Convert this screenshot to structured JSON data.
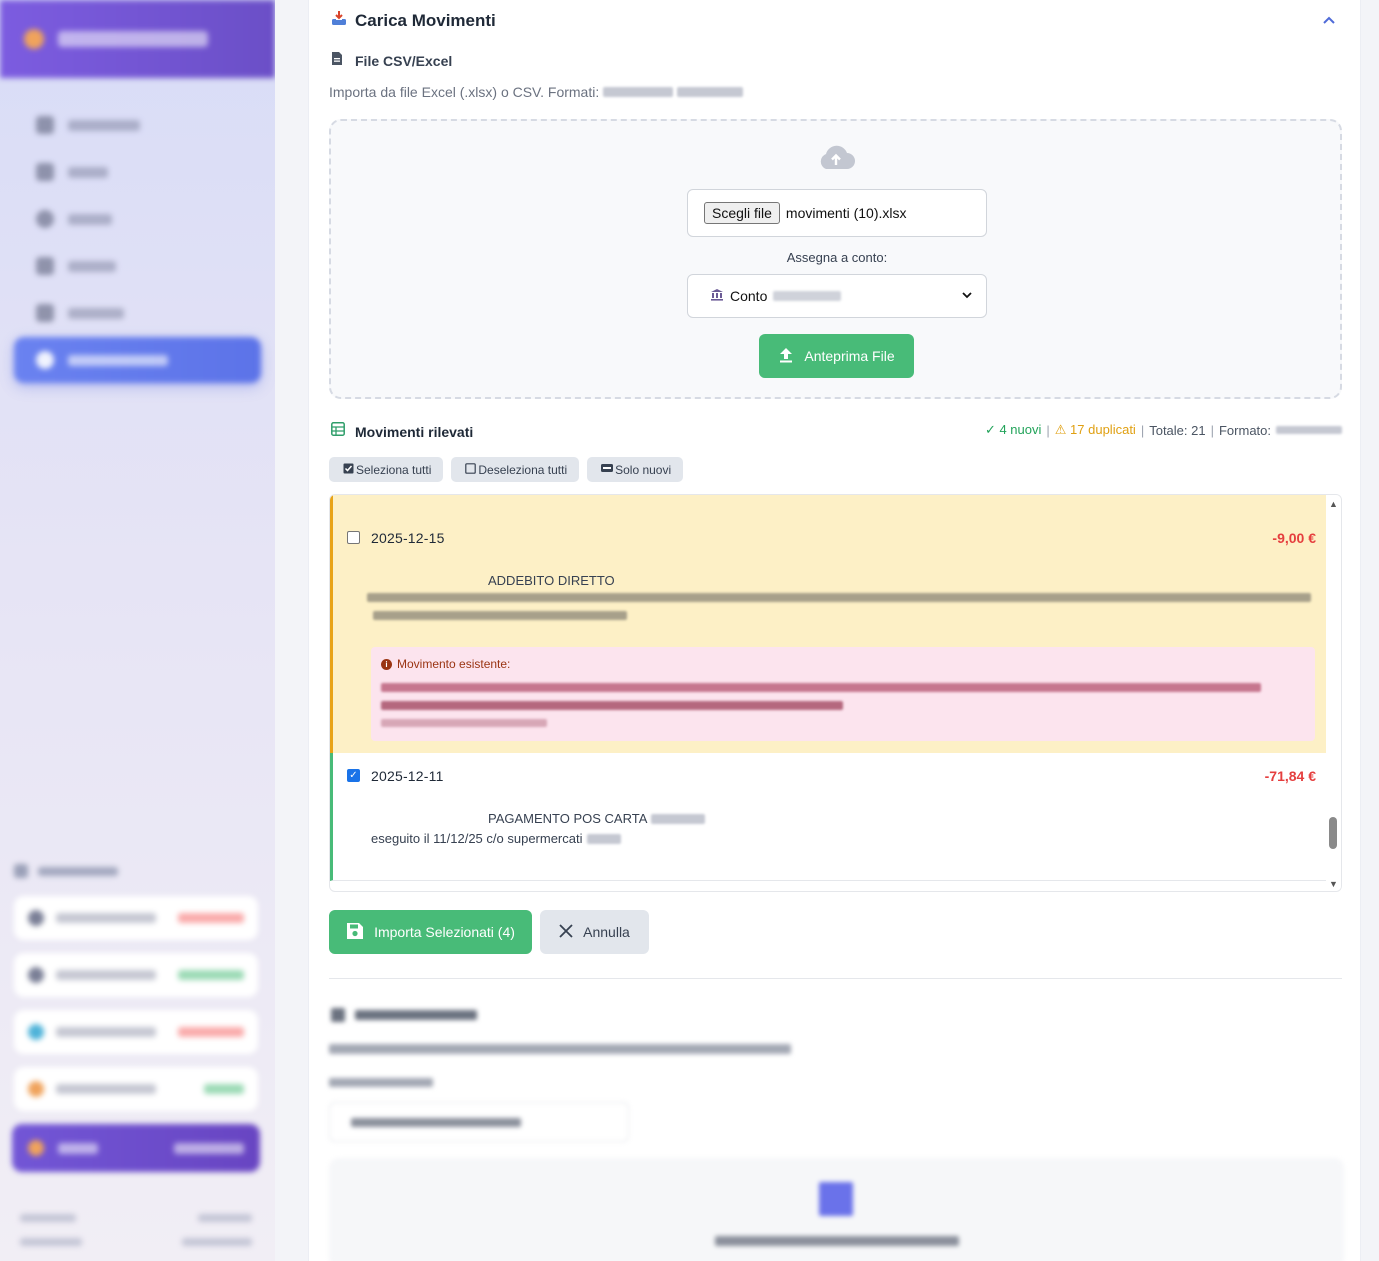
{
  "card": {
    "title": "Carica Movimenti",
    "collapse_icon": "chevron-up-icon"
  },
  "file_section": {
    "title": "File CSV/Excel",
    "description": "Importa da file Excel (.xlsx) o CSV. Formati:",
    "choose_file_label": "Scegli file",
    "selected_file": "movimenti (10).xlsx",
    "assign_label": "Assegna a conto:",
    "account_select_value": "Conto",
    "preview_button": "Anteprima File"
  },
  "movements": {
    "title": "Movimenti rilevati",
    "stats": {
      "new": "✓ 4 nuovi",
      "duplicates": "⚠ 17 duplicati",
      "total": "Totale: 21",
      "format": "Formato:"
    },
    "actions": {
      "select_all": "Seleziona tutti",
      "deselect_all": "Deseleziona tutti",
      "only_new": "Solo nuovi"
    },
    "rows": [
      {
        "date": "2025-12-15",
        "amount": "-9,00 €",
        "description": "ADDEBITO DIRETTO",
        "checked": false,
        "duplicate": true,
        "existing_label": "Movimento esistente:"
      },
      {
        "date": "2025-12-11",
        "amount": "-71,84 €",
        "description": "PAGAMENTO POS CARTA",
        "description_line2": "eseguito il 11/12/25 c/o supermercati",
        "checked": true,
        "duplicate": false
      }
    ]
  },
  "buttons": {
    "import_selected": "Importa Selezionati (4)",
    "cancel": "Annulla"
  },
  "colors": {
    "accent_green": "#48bb78",
    "negative_red": "#e53e3e",
    "duplicate_border": "#e8a317",
    "sidebar_active": "#5c73e8"
  }
}
